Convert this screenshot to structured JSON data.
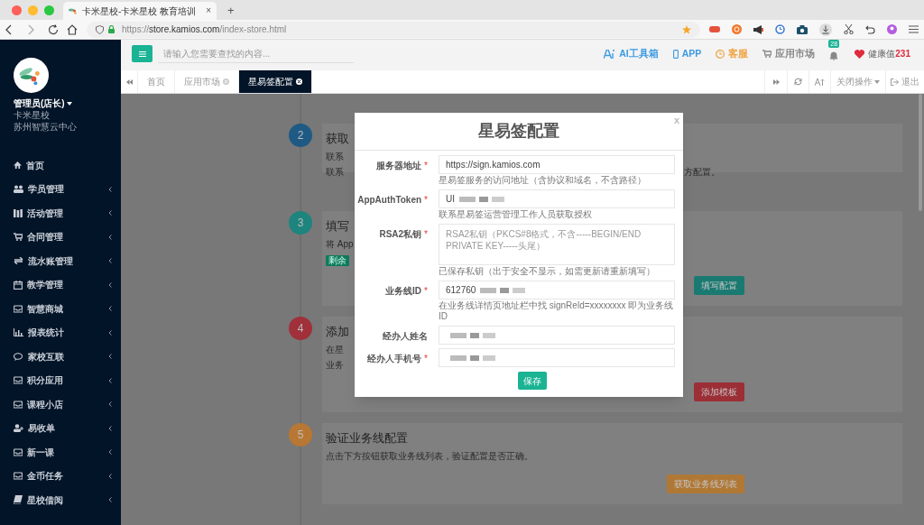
{
  "browser": {
    "tab_title": "卡米星校-卡米星校 教育培训",
    "close": "×",
    "new_tab": "+",
    "url_scheme": "https://",
    "url_host": "store.kamios.com",
    "url_path": "/index-store.html"
  },
  "sidebar": {
    "user": "管理员(店长)",
    "school": "卡米星校",
    "center": "苏州智慧云中心",
    "items": [
      {
        "label": "首页",
        "kind": "home",
        "expandable": false
      },
      {
        "label": "学员管理",
        "kind": "users",
        "expandable": true
      },
      {
        "label": "活动管理",
        "kind": "columns",
        "expandable": true
      },
      {
        "label": "合同管理",
        "kind": "cart",
        "expandable": true
      },
      {
        "label": "流水账管理",
        "kind": "swap",
        "expandable": true
      },
      {
        "label": "教学管理",
        "kind": "calendar",
        "expandable": true
      },
      {
        "label": "智慧商城",
        "kind": "tray",
        "expandable": true
      },
      {
        "label": "报表统计",
        "kind": "chart",
        "expandable": true
      },
      {
        "label": "家校互联",
        "kind": "chat",
        "expandable": true
      },
      {
        "label": "积分应用",
        "kind": "tray",
        "expandable": true
      },
      {
        "label": "课程小店",
        "kind": "tray",
        "expandable": true
      },
      {
        "label": "易收单",
        "kind": "user",
        "expandable": true
      },
      {
        "label": "新一课",
        "kind": "tray",
        "expandable": true
      },
      {
        "label": "金币任务",
        "kind": "tray",
        "expandable": true
      },
      {
        "label": "星校借阅",
        "kind": "book",
        "expandable": true
      }
    ]
  },
  "header": {
    "search_placeholder": "请输入您需要查找的内容...",
    "links": [
      {
        "label": "AI工具箱",
        "kind": "ai",
        "color": "#3b9ae1"
      },
      {
        "label": "APP",
        "kind": "phone",
        "color": "#3b9ae1"
      },
      {
        "label": "客服",
        "kind": "clock",
        "color": "#f0a23c"
      },
      {
        "label": "应用市场",
        "kind": "cart",
        "color": "#888888"
      }
    ],
    "notifications": "28",
    "health_label": "健康值",
    "health_value": "231"
  },
  "tabs": [
    {
      "label": "首页",
      "selected": false,
      "closable": false
    },
    {
      "label": "应用市场",
      "selected": false,
      "closable": true
    },
    {
      "label": "星易签配置",
      "selected": true,
      "closable": true
    }
  ],
  "tab_tools": {
    "close_ops": "关闭操作",
    "logout": "退出"
  },
  "steps": [
    {
      "number": "2",
      "color": "#1f5a85",
      "title": "获取",
      "lines": [
        {
          "text": "联系"
        },
        {
          "text": "联系",
          "tail": "方配置。"
        }
      ]
    },
    {
      "number": "3",
      "color": "#1e847e",
      "title": "填写",
      "lines": [
        {
          "text": "将 App"
        }
      ],
      "badge": "剩余",
      "button": {
        "label": "填写配置",
        "color": "#1a7a72"
      }
    },
    {
      "number": "4",
      "color": "#a0303a",
      "title": "添加",
      "lines": [
        {
          "text": "在星"
        },
        {
          "text": "业务"
        }
      ],
      "button": {
        "label": "添加模板",
        "color": "#9c2e36"
      }
    },
    {
      "number": "5",
      "color": "#b87733",
      "title": "验证业务线配置",
      "lines": [
        {
          "text": "点击下方按钮获取业务线列表，验证配置是否正确。"
        }
      ],
      "button": {
        "label": "获取业务线列表",
        "color": "#b07835"
      }
    }
  ],
  "modal": {
    "title": "星易签配置",
    "close": "x",
    "fields": [
      {
        "label": "服务器地址",
        "mark": "*",
        "kind": "input",
        "value": "https://sign.kamios.com",
        "redacted": false,
        "hint": "星易签服务的访问地址（含协议和域名，不含路径）"
      },
      {
        "label": "AppAuthToken",
        "mark": "*",
        "kind": "input",
        "value": "UI",
        "redacted": true,
        "hint": "联系星易签运营管理工作人员获取授权"
      },
      {
        "label": "RSA2私钥",
        "mark": "*",
        "kind": "textarea",
        "placeholder": "RSA2私钥（PKCS#8格式，不含-----BEGIN/END PRIVATE KEY-----头尾）",
        "hint": "已保存私钥（出于安全不显示，如需更新请重新填写）"
      },
      {
        "label": "业务线ID",
        "mark": "*",
        "kind": "input",
        "value": "612760",
        "redacted": true,
        "hint": "在业务线详情页地址栏中找 signReld=xxxxxxxx 即为业务线ID"
      },
      {
        "label": "经办人姓名",
        "kind": "input",
        "redacted": true
      },
      {
        "label": "经办人手机号",
        "mark": "*",
        "kind": "input",
        "redacted": true
      }
    ],
    "save": "保存"
  }
}
